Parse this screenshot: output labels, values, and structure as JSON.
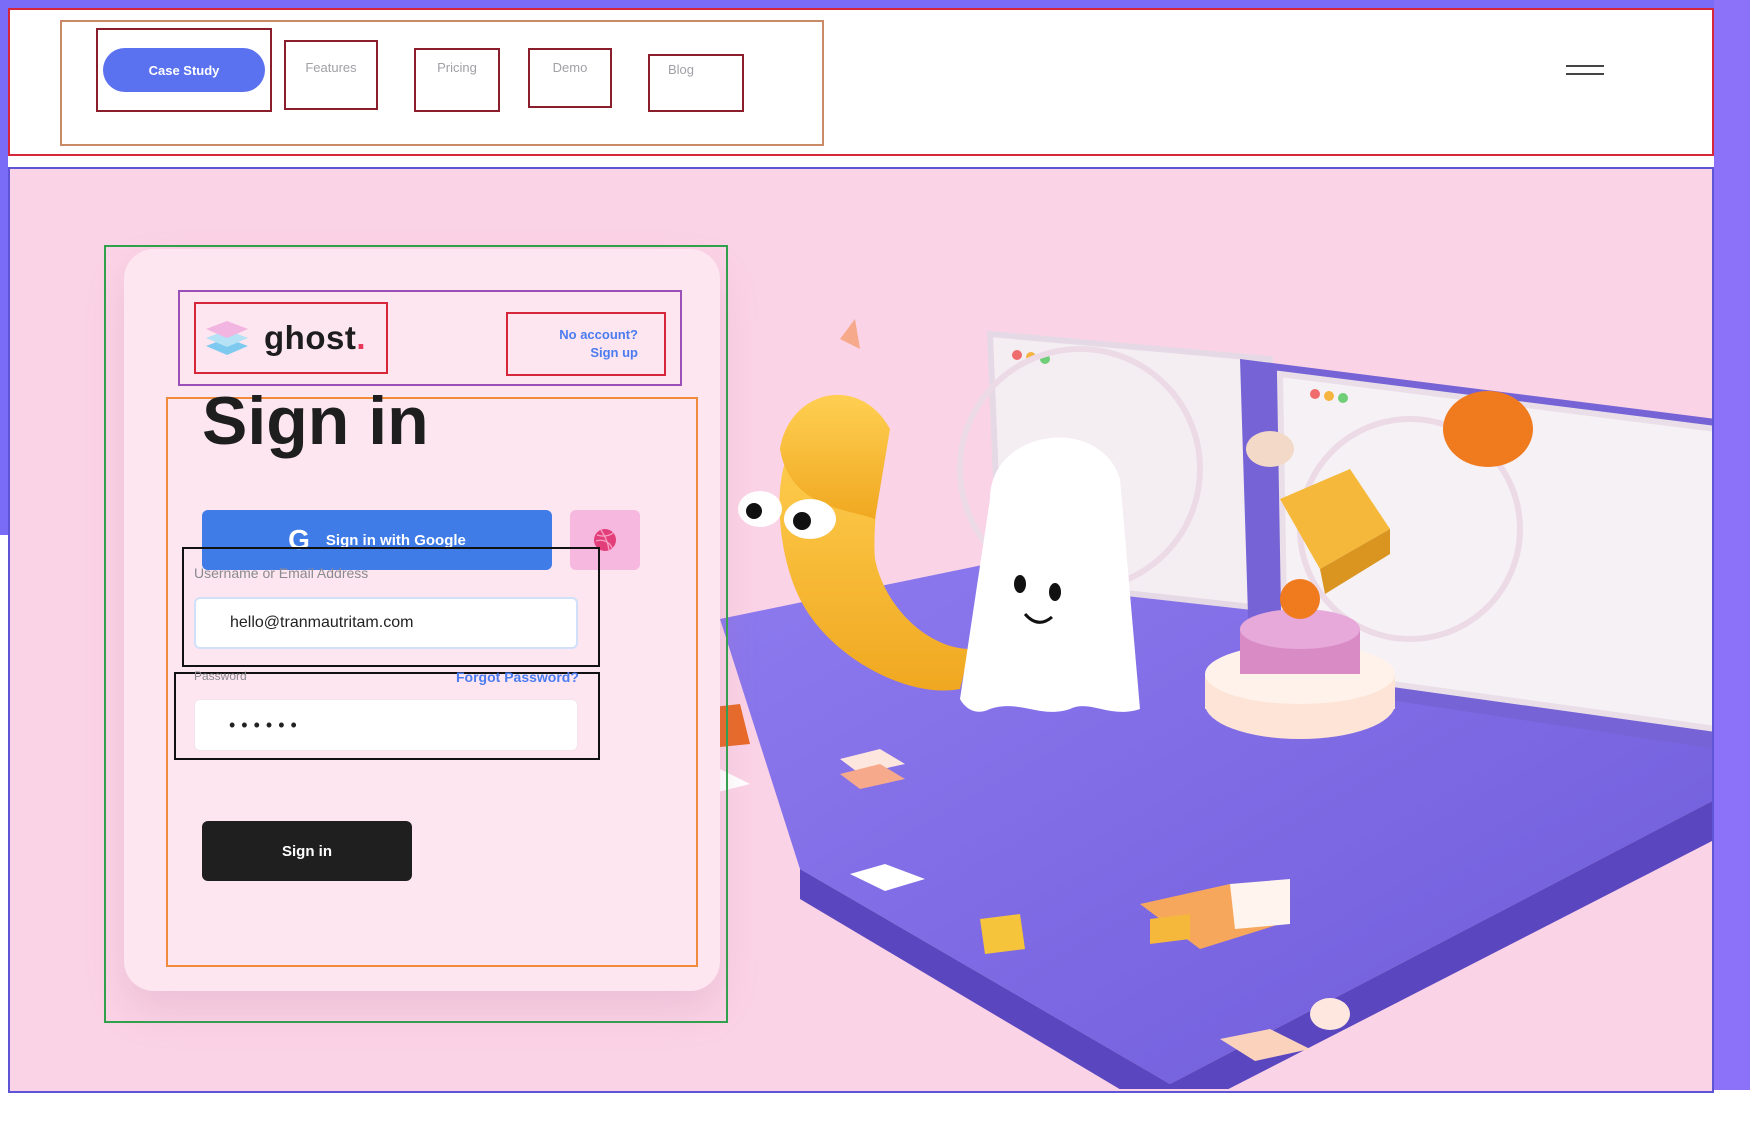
{
  "nav": {
    "items": [
      {
        "label": "Case Study",
        "active": true
      },
      {
        "label": "Features"
      },
      {
        "label": "Pricing"
      },
      {
        "label": "Demo"
      },
      {
        "label": "Blog"
      }
    ],
    "menu_icon": "hamburger-icon"
  },
  "login": {
    "brand": "ghost",
    "brand_dot": ".",
    "no_account": "No account?",
    "sign_up": "Sign up",
    "title": "Sign in",
    "google_button": "Sign in with Google",
    "google_icon": "G",
    "dribbble_icon": "dribbble-icon",
    "username_label": "Username or Email Address",
    "username_value": "hello@tranmautritam.com",
    "password_label": "Password",
    "password_value": "••••••",
    "forgot_password": "Forgot Password?",
    "submit": "Sign in"
  },
  "colors": {
    "accent": "#5a72ef",
    "google_blue": "#3f7ce8",
    "hero_bg": "#fbd3e6",
    "card_bg": "#fde6f0",
    "dark_button": "#1f1f1f",
    "link": "#4a7bf0"
  }
}
